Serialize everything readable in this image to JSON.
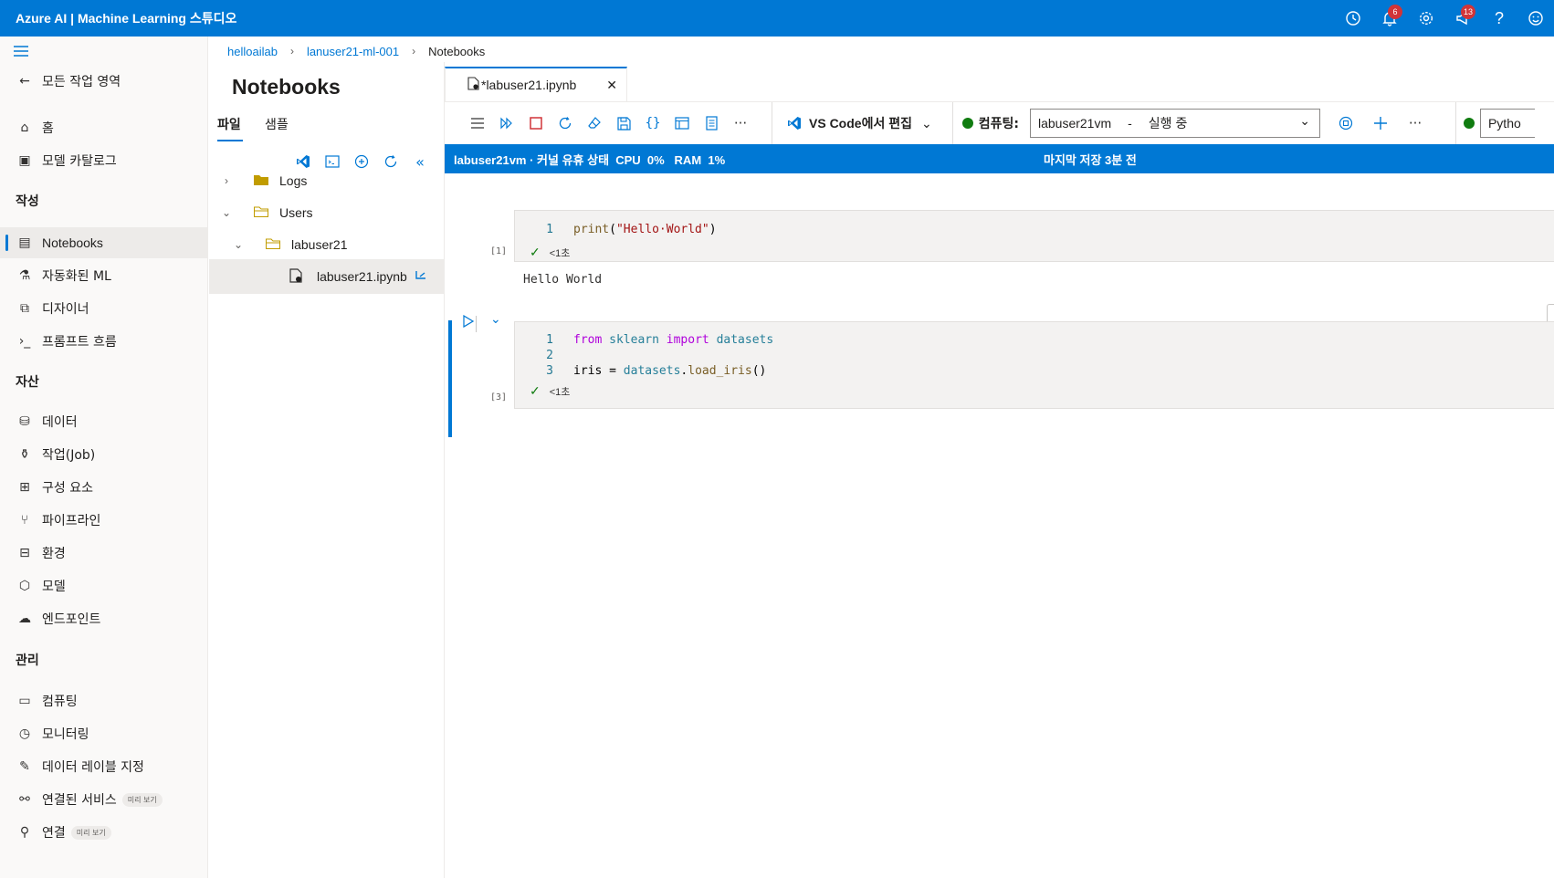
{
  "header": {
    "title": "Azure AI | Machine Learning 스튜디오",
    "notifications_count": "6",
    "feedback_count": "13",
    "icons": [
      "clock-icon",
      "bell-icon",
      "gear-icon",
      "megaphone-icon",
      "help-icon",
      "smiley-icon"
    ]
  },
  "nav": {
    "back_label": "모든 작업 영역",
    "home": "홈",
    "model_catalog": "모델 카탈로그",
    "section_author": "작성",
    "notebooks": "Notebooks",
    "automl": "자동화된 ML",
    "designer": "디자이너",
    "prompt_flow": "프롬프트 흐름",
    "section_assets": "자산",
    "data": "데이터",
    "jobs": "작업(Job)",
    "components": "구성 요소",
    "pipelines": "파이프라인",
    "environments": "환경",
    "models": "모델",
    "endpoints": "엔드포인트",
    "section_manage": "관리",
    "compute": "컴퓨팅",
    "monitoring": "모니터링",
    "data_labeling": "데이터 레이블 지정",
    "linked_services": "연결된 서비스",
    "connections": "연결",
    "preview_tag": "미리 보기"
  },
  "breadcrumb": [
    "helloailab",
    "lanuser21-ml-001",
    "Notebooks"
  ],
  "filepane": {
    "title": "Notebooks",
    "tab_files": "파일",
    "tab_samples": "샘플",
    "tree": {
      "logs": "Logs",
      "users": "Users",
      "user_folder": "labuser21",
      "notebook_file": "labuser21.ipynb"
    }
  },
  "notebook": {
    "tab_label": "*labuser21.ipynb",
    "vscode_label": "VS Code에서 편집",
    "compute_label": "컴퓨팅:",
    "compute_value": "labuser21vm",
    "compute_status": "실행 중",
    "kernel_partial": "Pytho",
    "status_left": "labuser21vm · 커널 유휴 상태  CPU  0%   RAM  1%",
    "status_right": "마지막 저장 3분 전",
    "cell1": {
      "exec_count": "[1]",
      "line_numbers": [
        "1"
      ],
      "duration": "<1초",
      "output": "Hello World"
    },
    "cell2": {
      "exec_count": "[3]",
      "line_numbers": [
        "1",
        "2",
        "3"
      ],
      "duration": "<1초"
    }
  }
}
